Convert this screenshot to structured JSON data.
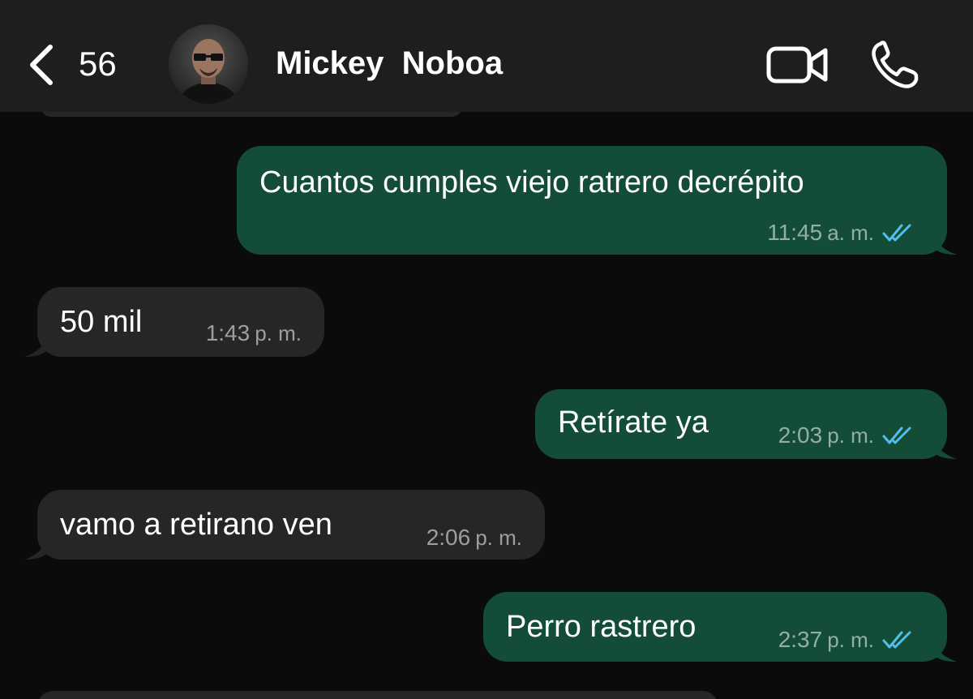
{
  "header": {
    "back_count": "56",
    "contact_name": "Mickey  Noboa",
    "icons": {
      "back": "chevron-left-icon",
      "video": "video-camera-icon",
      "call": "phone-icon"
    }
  },
  "colors": {
    "background": "#0b0b0b",
    "header": "#1e1e1f",
    "outgoing_bubble": "#134d37",
    "incoming_bubble": "#262627",
    "read_ticks": "#53bdeb"
  },
  "messages": [
    {
      "direction": "outgoing",
      "text": "Cuantos cumples viejo ratrero decrépito",
      "time": "11:45",
      "period": "a. m.",
      "read": true
    },
    {
      "direction": "incoming",
      "text": "50 mil",
      "time": "1:43",
      "period": "p. m."
    },
    {
      "direction": "outgoing",
      "text": "Retírate ya",
      "time": "2:03",
      "period": "p. m.",
      "read": true
    },
    {
      "direction": "incoming",
      "text": "vamo a retirano ven",
      "time": "2:06",
      "period": "p. m."
    },
    {
      "direction": "outgoing",
      "text": "Perro rastrero",
      "time": "2:37",
      "period": "p. m.",
      "read": true
    }
  ]
}
